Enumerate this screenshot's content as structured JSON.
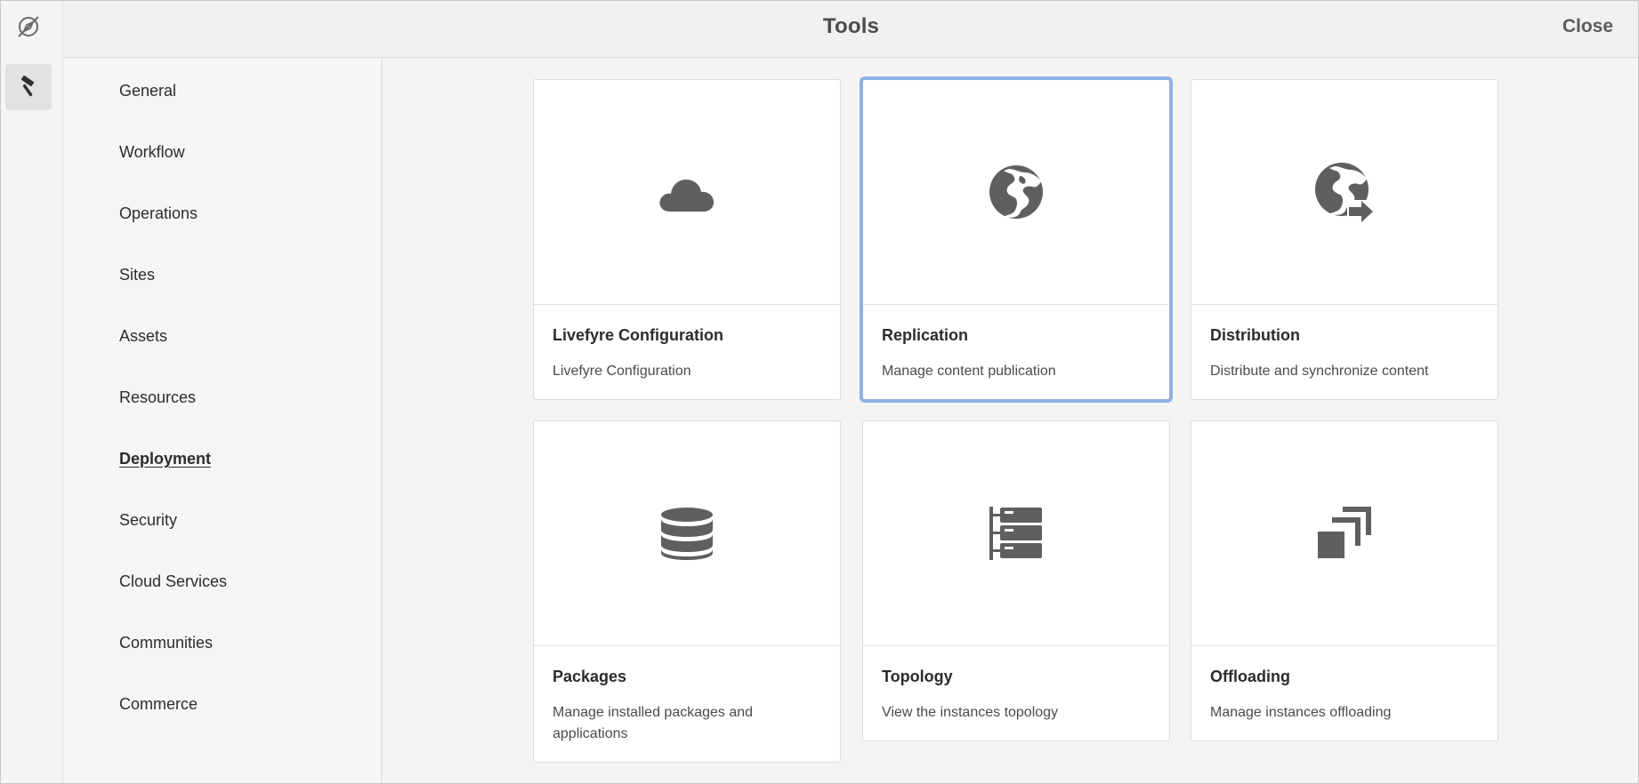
{
  "header": {
    "title": "Tools",
    "close_label": "Close"
  },
  "rail": {
    "logo_icon": "compass-slash-icon",
    "tool_icon": "hammer-icon"
  },
  "nav": {
    "items": [
      {
        "label": "General",
        "active": false
      },
      {
        "label": "Workflow",
        "active": false
      },
      {
        "label": "Operations",
        "active": false
      },
      {
        "label": "Sites",
        "active": false
      },
      {
        "label": "Assets",
        "active": false
      },
      {
        "label": "Resources",
        "active": false
      },
      {
        "label": "Deployment",
        "active": true
      },
      {
        "label": "Security",
        "active": false
      },
      {
        "label": "Cloud Services",
        "active": false
      },
      {
        "label": "Communities",
        "active": false
      },
      {
        "label": "Commerce",
        "active": false
      }
    ]
  },
  "cards": [
    {
      "title": "Livefyre Configuration",
      "description": "Livefyre Configuration",
      "icon": "cloud-icon",
      "selected": false
    },
    {
      "title": "Replication",
      "description": "Manage content publication",
      "icon": "globe-icon",
      "selected": true
    },
    {
      "title": "Distribution",
      "description": "Distribute and synchronize content",
      "icon": "globe-arrow-icon",
      "selected": false
    },
    {
      "title": "Packages",
      "description": "Manage installed packages and applications",
      "icon": "database-icon",
      "selected": false
    },
    {
      "title": "Topology",
      "description": "View the instances topology",
      "icon": "server-tree-icon",
      "selected": false
    },
    {
      "title": "Offloading",
      "description": "Manage instances offloading",
      "icon": "stacked-squares-icon",
      "selected": false
    }
  ],
  "colors": {
    "accent_selected": "#8fb2e6",
    "icon": "#5f5f5f"
  }
}
